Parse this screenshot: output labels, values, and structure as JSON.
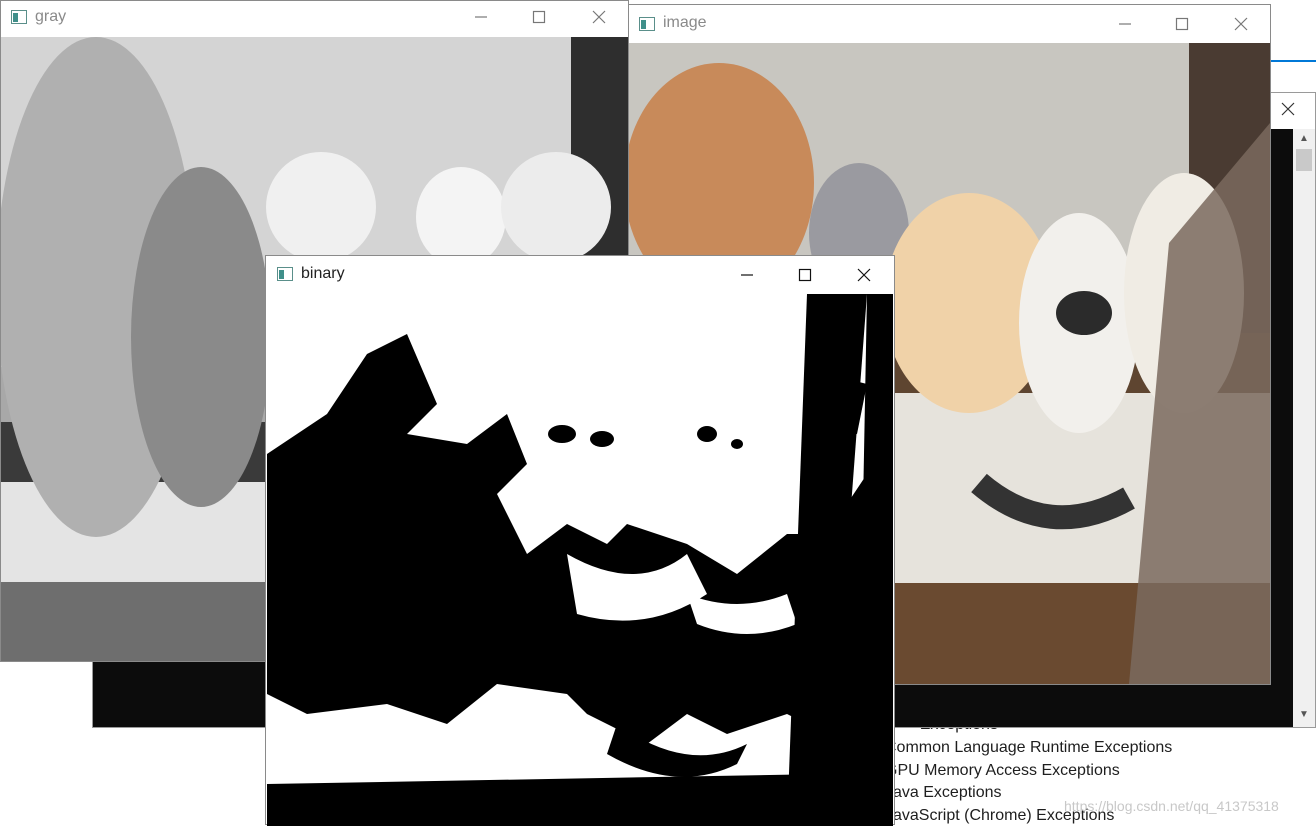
{
  "windows": {
    "gray": {
      "title": "gray"
    },
    "image": {
      "title": "image"
    },
    "binary": {
      "title": "binary"
    }
  },
  "background_panel": {
    "exceptions": [
      "C++ Exceptions",
      "Common Language Runtime Exceptions",
      "GPU Memory Access Exceptions",
      "Java Exceptions",
      "JavaScript (Chrome) Exceptions"
    ]
  },
  "watermark": "https://blog.csdn.net/qq_41375318",
  "colors": {
    "accent": "#0078d7",
    "console": "#0c0c0c",
    "window_border": "#8a8a8a"
  },
  "icons": [
    "app-icon",
    "minimize-icon",
    "maximize-icon",
    "close-icon"
  ]
}
